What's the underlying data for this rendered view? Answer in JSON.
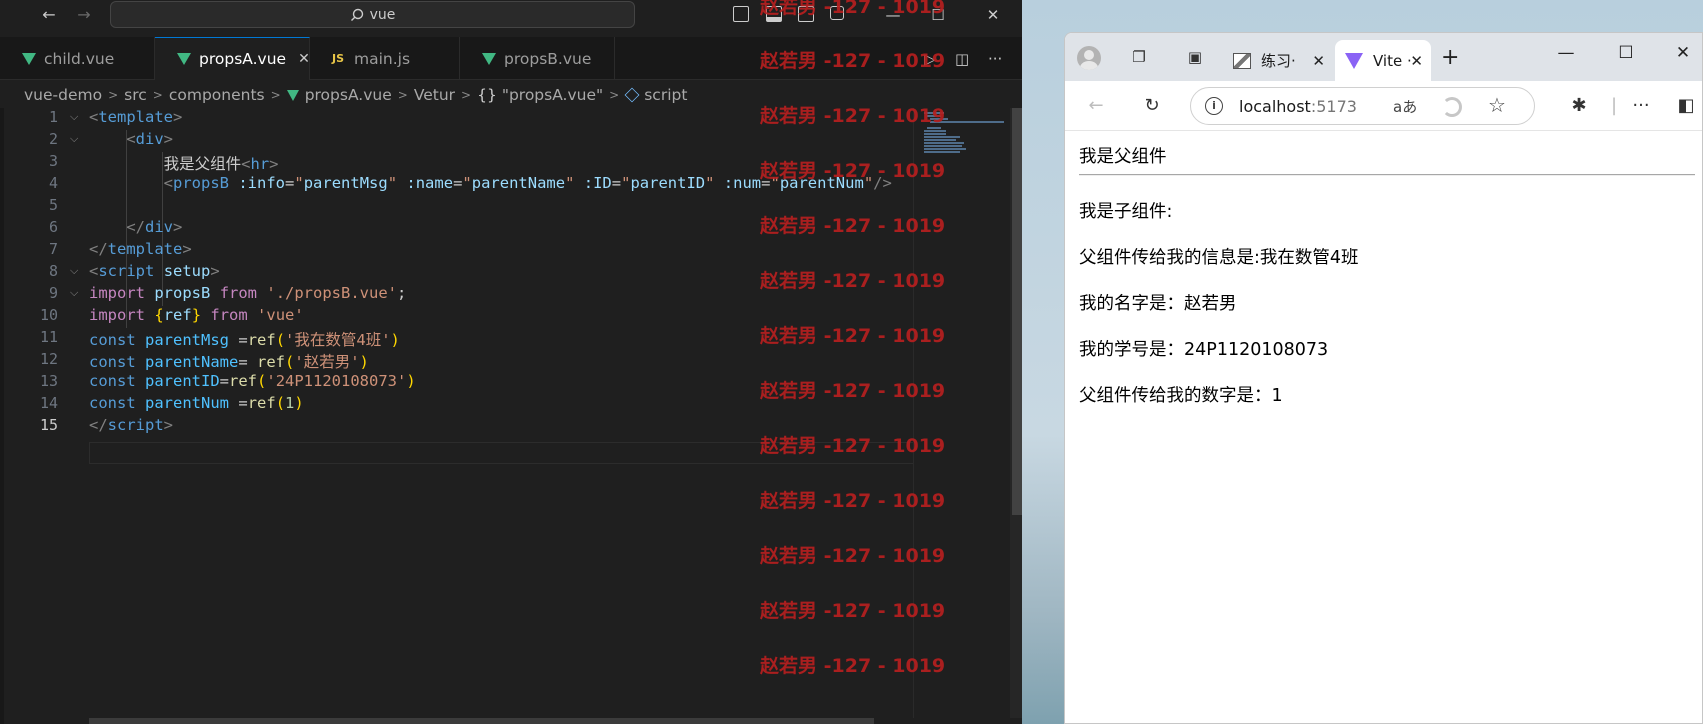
{
  "vscode": {
    "search": "vue",
    "tabs": [
      {
        "label": "child.vue",
        "icon": "vue-icon"
      },
      {
        "label": "propsA.vue",
        "icon": "vue-icon",
        "active": true
      },
      {
        "label": "main.js",
        "icon": "js-icon"
      },
      {
        "label": "propsB.vue",
        "icon": "vue-icon"
      }
    ],
    "js_badge": "JS",
    "breadcrumb": [
      "vue-demo",
      "src",
      "components",
      "propsA.vue",
      "Vetur",
      "\"propsA.vue\"",
      "script"
    ],
    "breadcrumb_braces": "{}",
    "line_numbers": [
      "1",
      "2",
      "3",
      "4",
      "5",
      "6",
      "7",
      "8",
      "9",
      "10",
      "11",
      "12",
      "13",
      "14",
      "15"
    ],
    "current_line": "15"
  },
  "watermark": "赵若男 -127 - 1019",
  "browser": {
    "tabs": [
      {
        "label": "练习·"
      },
      {
        "label": "Vite ·",
        "active": true
      }
    ],
    "url_host": "localhost",
    "url_port": ":5173",
    "read_aloud": "aあ",
    "page": {
      "parent_title": "我是父组件",
      "child_title": "我是子组件:",
      "info_line": "父组件传给我的信息是:我在数管4班",
      "name_line": "我的名字是：赵若男",
      "id_line": "我的学号是：24P1120108073",
      "num_line": "父组件传给我的数字是：1"
    }
  }
}
